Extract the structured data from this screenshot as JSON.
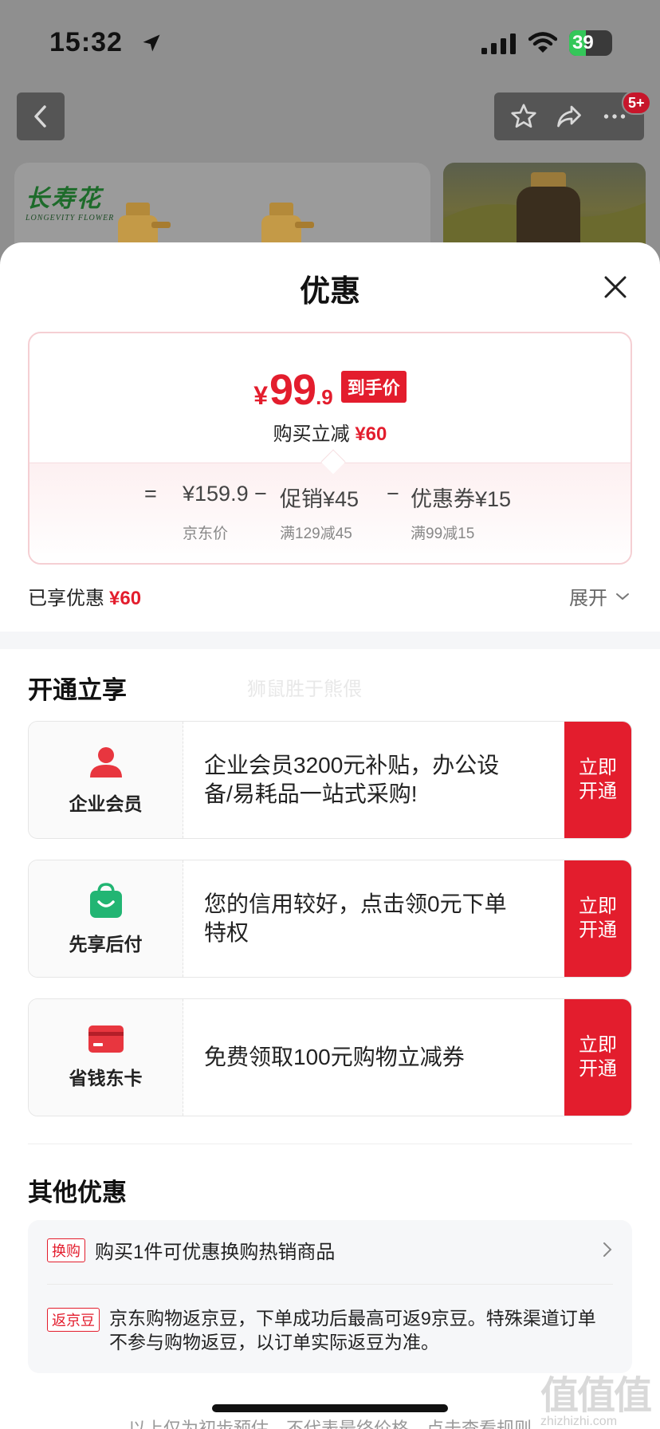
{
  "status_bar": {
    "time": "15:32",
    "battery": "39"
  },
  "nav": {
    "badge": "5+"
  },
  "brand": {
    "name_cn": "长寿花",
    "name_en": "LONGEVITY FLOWER"
  },
  "sheet": {
    "title": "优惠",
    "price": {
      "symbol": "¥",
      "integer": "99",
      "decimal": ".9",
      "tag": "到手价",
      "subtitle_prefix": "购买立减",
      "subtitle_amount": "¥60"
    },
    "formula": {
      "equals": "=",
      "base_price": "¥159.9",
      "base_label": "京东价",
      "minus1": "−",
      "promo": "促销¥45",
      "promo_note": "满129减45",
      "minus2": "−",
      "coupon": "优惠券¥15",
      "coupon_note": "满99减15"
    },
    "enjoyed": {
      "label": "已享优惠",
      "amount": "¥60",
      "expand": "展开"
    }
  },
  "watermark": "狮鼠胜于熊偎",
  "activate": {
    "title": "开通立享",
    "cards": [
      {
        "name": "企业会员",
        "icon": "person-icon",
        "desc": "企业会员3200元补贴，办公设备/易耗品一站式采购!",
        "button": "立即开通"
      },
      {
        "name": "先享后付",
        "icon": "shopping-bag-icon",
        "desc": "您的信用较好，点击领0元下单特权",
        "button": "立即开通"
      },
      {
        "name": "省钱东卡",
        "icon": "card-icon",
        "desc": "免费领取100元购物立减券",
        "button": "立即开通"
      }
    ]
  },
  "other": {
    "title": "其他优惠",
    "items": [
      {
        "tag": "换购",
        "text": "购买1件可优惠换购热销商品"
      },
      {
        "tag": "返京豆",
        "text": "京东购物返京豆，下单成功后最高可返9京豆。特殊渠道订单不参与购物返豆，以订单实际返豆为准。"
      }
    ]
  },
  "footer": "以上仅为初步预估，不代表最终价格，点击查看规则",
  "corner_watermark": {
    "big": "值值值",
    "small": "zhizhizhi.com"
  },
  "colors": {
    "accent": "#e31d2d",
    "green": "#22b573"
  }
}
